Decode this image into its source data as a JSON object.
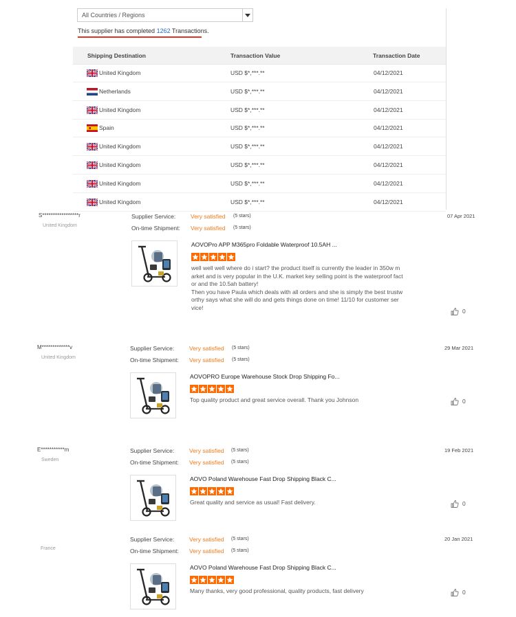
{
  "transactions": {
    "filter_value": "All Countries / Regions",
    "summary_prefix": "This supplier has completed ",
    "summary_count": "1262",
    "summary_suffix": " Transactions.",
    "headers": {
      "destination": "Shipping Destination",
      "value": "Transaction Value",
      "date": "Transaction Date"
    },
    "rows": [
      {
        "flag": "uk-flag-icon",
        "country": "United Kingdom",
        "value": "USD $*,***.**",
        "date": "04/12/2021"
      },
      {
        "flag": "netherlands-flag-icon",
        "country": "Netherlands",
        "value": "USD $*,***.**",
        "date": "04/12/2021"
      },
      {
        "flag": "uk-flag-icon",
        "country": "United Kingdom",
        "value": "USD $*,***.**",
        "date": "04/12/2021"
      },
      {
        "flag": "spain-flag-icon",
        "country": "Spain",
        "value": "USD $*,***.**",
        "date": "04/12/2021"
      },
      {
        "flag": "uk-flag-icon",
        "country": "United Kingdom",
        "value": "USD $*,***.**",
        "date": "04/12/2021"
      },
      {
        "flag": "uk-flag-icon",
        "country": "United Kingdom",
        "value": "USD $*,***.**",
        "date": "04/12/2021"
      },
      {
        "flag": "uk-flag-icon",
        "country": "United Kingdom",
        "value": "USD $*,***.**",
        "date": "04/12/2021"
      },
      {
        "flag": "uk-flag-icon",
        "country": "United Kingdom",
        "value": "USD $*,***.**",
        "date": "04/12/2021"
      }
    ]
  },
  "review_labels": {
    "service": "Supplier Service:",
    "shipment": "On-time Shipment:"
  },
  "reviews": [
    {
      "buyer": "S*****************r",
      "country": "United Kingdom",
      "service_rating": "Very satisfied",
      "service_stars": "(5 stars)",
      "shipment_rating": "Very satisfied",
      "shipment_stars": "(5 stars)",
      "date": "07 Apr 2021",
      "product_title": "AOVOPro APP M365pro Foldable Waterproof 10.5AH ...",
      "stars": 5,
      "text_lines": [
        "well well well where do i start? the product itself is currently the leader in 350w m",
        "arket and is very popular in the U.K. market key selling point is the waterproof fact",
        "or and the 10.5ah battery!",
        "Then you have Paula which deals with all orders and she is simply the best trustw",
        "orthy says what she will do and gets things done on time! 11/10 for customer ser",
        "vice!"
      ],
      "likes": "0"
    },
    {
      "buyer": "M*************v",
      "country": "United Kingdom",
      "service_rating": "Very satisfied",
      "service_stars": "(5 stars)",
      "shipment_rating": "Very satisfied",
      "shipment_stars": "(5 stars)",
      "date": "29 Mar 2021",
      "product_title": "AOVOPRO Europe Warehouse Stock Drop Shipping Fo...",
      "stars": 5,
      "text_lines": [
        "Top quality product and great service overall. Thank you Johnson"
      ],
      "likes": "0"
    },
    {
      "buyer": "E***********m",
      "country": "Sweden",
      "service_rating": "Very satisfied",
      "service_stars": "(5 stars)",
      "shipment_rating": "Very satisfied",
      "shipment_stars": "(5 stars)",
      "date": "19 Feb 2021",
      "product_title": "AOVO Poland Warehouse Fast Drop Shipping Black C...",
      "stars": 5,
      "text_lines": [
        "Great quality and service as usual! Fast delivery."
      ],
      "likes": "0"
    },
    {
      "buyer": "",
      "country": "France",
      "service_rating": "Very satisfied",
      "service_stars": "(5 stars)",
      "shipment_rating": "Very satisfied",
      "shipment_stars": "(5 stars)",
      "date": "20 Jan 2021",
      "product_title": "AOVO Poland Warehouse Fast Drop Shipping Black C...",
      "stars": 5,
      "text_lines": [
        "Many thanks, very good professional, quality products, fast delivery"
      ],
      "likes": "0"
    }
  ]
}
